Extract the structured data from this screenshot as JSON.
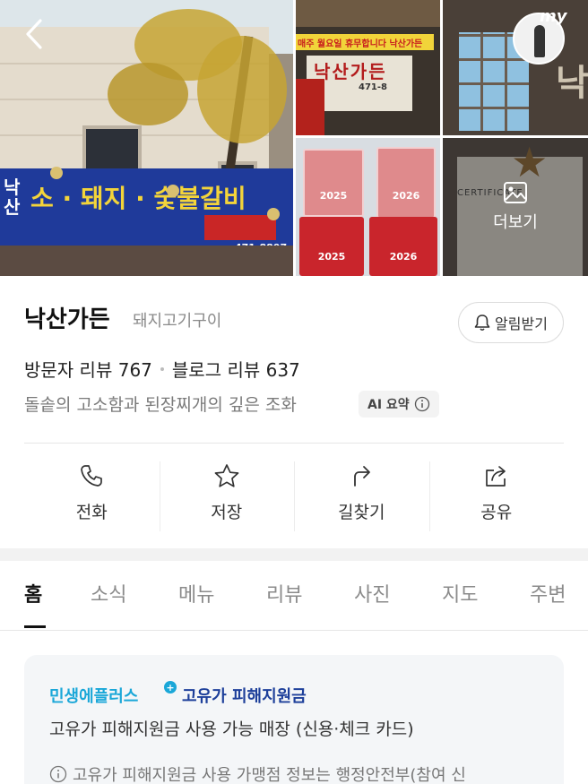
{
  "gallery": {
    "main_sign": {
      "left_vertical": "낙산",
      "big_text": "소 · 돼지 · 숯불갈비",
      "phone": "471-8897"
    },
    "photo_a": {
      "banner": "매주 월요일 휴무합니다 낙산가든",
      "sign_vertical": "낙산가든",
      "sign_phone": "471-8"
    },
    "photo_b": {
      "profile_text": "my",
      "side_text": "낙산"
    },
    "photo_c": {
      "award_year_top_left": "2025",
      "award_year_top_right": "2026",
      "award_year_bottom_left": "2025",
      "award_year_bottom_right": "2026"
    },
    "photo_d": {
      "cert_heading": "CERTIFICATE",
      "more_label": "더보기"
    },
    "icons": {
      "back": "chevron-left-icon",
      "more": "image-icon"
    }
  },
  "place": {
    "name": "낙산가든",
    "category": "돼지고기구이",
    "notify_label": "알림받기",
    "visitor_reviews": "방문자 리뷰 767",
    "blog_reviews": "블로그 리뷰 637",
    "summary": "돌솥의 고소함과 된장찌개의 깊은 조화",
    "ai_badge": "AI 요약"
  },
  "actions": [
    {
      "label": "전화",
      "icon": "phone-icon"
    },
    {
      "label": "저장",
      "icon": "star-icon"
    },
    {
      "label": "길찾기",
      "icon": "directions-icon"
    },
    {
      "label": "공유",
      "icon": "share-icon"
    }
  ],
  "tabs": [
    "홈",
    "소식",
    "메뉴",
    "리뷰",
    "사진",
    "지도",
    "주변"
  ],
  "active_tab": "홈",
  "promo": {
    "brand": "민생에플러스",
    "plus": "+",
    "title": "고유가 피해지원금",
    "description": "고유가 피해지원금 사용 가능 매장 (신용·체크 카드)",
    "note": "고유가 피해지원금 사용 가맹점 정보는 행정안전부(참여 신"
  },
  "colors": {
    "brand_blue": "#1aa7d8",
    "promo_navy": "#1d3f9a",
    "sign_blue": "#1f3a9a",
    "sign_red": "#c92626"
  }
}
